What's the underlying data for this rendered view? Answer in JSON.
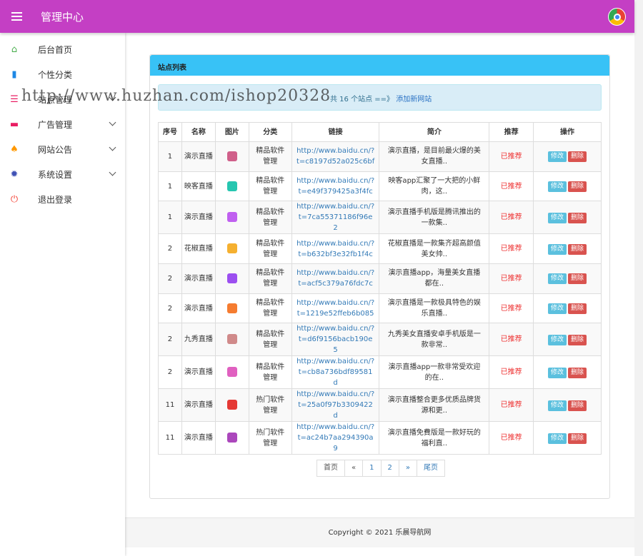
{
  "header": {
    "title": "管理中心"
  },
  "sidebar": {
    "items": [
      {
        "label": "后台首页",
        "icon": "home-icon",
        "color": "#4caf50",
        "glyph": "⌂",
        "arrow": false
      },
      {
        "label": "个性分类",
        "icon": "bookmark-icon",
        "color": "#1e88e5",
        "glyph": "▮",
        "arrow": false
      },
      {
        "label": "站点管理",
        "icon": "list-icon",
        "color": "#e91e63",
        "glyph": "☰",
        "arrow": true
      },
      {
        "label": "广告管理",
        "icon": "card-icon",
        "color": "#e91e63",
        "glyph": "▬",
        "arrow": true
      },
      {
        "label": "网站公告",
        "icon": "bell-icon",
        "color": "#ff9800",
        "glyph": "♠",
        "arrow": true
      },
      {
        "label": "系统设置",
        "icon": "gear-icon",
        "color": "#3f51b5",
        "glyph": "✹",
        "arrow": true
      },
      {
        "label": "退出登录",
        "icon": "power-icon",
        "color": "#f44336",
        "glyph": "⏻",
        "arrow": false
      }
    ]
  },
  "panel": {
    "title": "站点列表",
    "alert_text": "共 16 个站点 ==》",
    "alert_link": "添加新网站"
  },
  "table": {
    "headers": [
      "序号",
      "名称",
      "图片",
      "分类",
      "链接",
      "简介",
      "推荐",
      "操作"
    ],
    "rows": [
      {
        "id": "1",
        "name": "演示直播",
        "thumb": "#d0608a",
        "cat": "精品软件管理",
        "url": "http://www.baidu.cn/?t=c8197d52a025c6bf",
        "desc": "演示直播，是目前最火爆的美女直播..",
        "rec": "已推荐"
      },
      {
        "id": "1",
        "name": "映客直播",
        "thumb": "#26c6b0",
        "cat": "精品软件管理",
        "url": "http://www.baidu.cn/?t=e49f379425a3f4fc",
        "desc": "映客app汇聚了一大把的小鲜肉，这..",
        "rec": "已推荐"
      },
      {
        "id": "1",
        "name": "演示直播",
        "thumb": "#c060f0",
        "cat": "精品软件管理",
        "url": "http://www.baidu.cn/?t=7ca55371186f96e2",
        "desc": "演示直播手机版是腾讯推出的一款集..",
        "rec": "已推荐"
      },
      {
        "id": "2",
        "name": "花椒直播",
        "thumb": "#f5b030",
        "cat": "精品软件管理",
        "url": "http://www.baidu.cn/?t=b632bf3e32fb1f4c",
        "desc": "花椒直播是一款集齐超高颜值美女帅..",
        "rec": "已推荐"
      },
      {
        "id": "2",
        "name": "演示直播",
        "thumb": "#9c4ff0",
        "cat": "精品软件管理",
        "url": "http://www.baidu.cn/?t=acf5c379a76fdc7c",
        "desc": "演示直播app，海量美女直播都在..",
        "rec": "已推荐"
      },
      {
        "id": "2",
        "name": "演示直播",
        "thumb": "#f57c30",
        "cat": "精品软件管理",
        "url": "http://www.baidu.cn/?t=1219e52ffeb6b085",
        "desc": "演示直播是一款极具特色的娱乐直播..",
        "rec": "已推荐"
      },
      {
        "id": "2",
        "name": "九秀直播",
        "thumb": "#d08a8a",
        "cat": "精品软件管理",
        "url": "http://www.baidu.cn/?t=d6f9156bacb190e5",
        "desc": "九秀美女直播安卓手机版是一款非常..",
        "rec": "已推荐"
      },
      {
        "id": "2",
        "name": "演示直播",
        "thumb": "#e060c0",
        "cat": "精品软件管理",
        "url": "http://www.baidu.cn/?t=cb8a736bdf89581d",
        "desc": "演示直播app一款非常受欢迎的在..",
        "rec": "已推荐"
      },
      {
        "id": "11",
        "name": "演示直播",
        "thumb": "#e53935",
        "cat": "热门软件管理",
        "url": "http://www.baidu.cn/?t=25a0f97b3309422d",
        "desc": "演示直播整合更多优质品牌货源和更..",
        "rec": "已推荐"
      },
      {
        "id": "11",
        "name": "演示直播",
        "thumb": "#ab47bc",
        "cat": "热门软件管理",
        "url": "http://www.baidu.cn/?t=ac24b7aa294390a9",
        "desc": "演示直播免費版是一款好玩的福利直..",
        "rec": "已推荐"
      }
    ],
    "edit_label": "修改",
    "delete_label": "删除"
  },
  "pagination": [
    "首页",
    "«",
    "1",
    "2",
    "»",
    "尾页"
  ],
  "footer": {
    "text": "Copyright © 2021 乐晨导航网"
  },
  "watermark": "http://www.huzhan.com/ishop20328"
}
